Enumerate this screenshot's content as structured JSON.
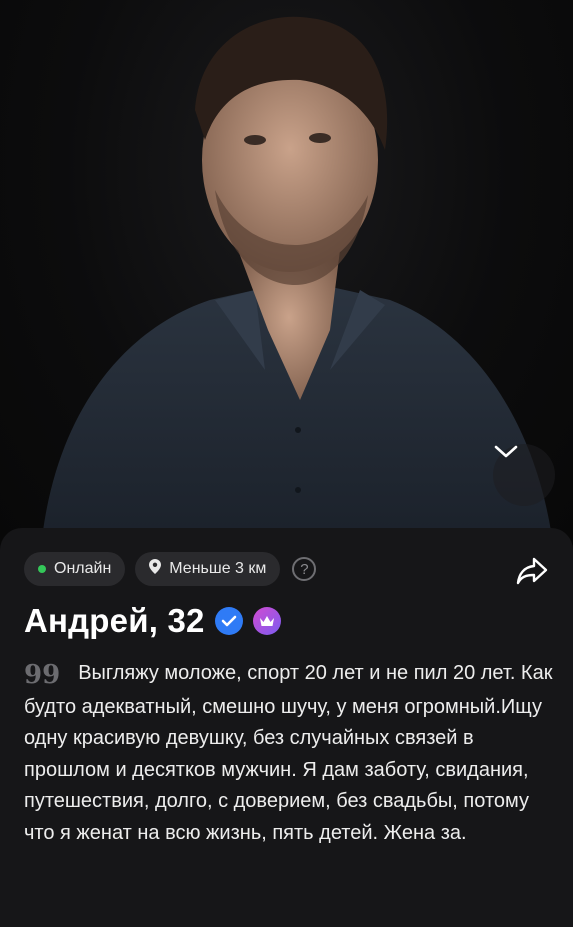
{
  "profile": {
    "status": "Онлайн",
    "distance": "Меньше 3 км",
    "help": "?",
    "name_age": "Андрей, 32",
    "bio": "Выгляжу моложе, спорт 20 лет и не пил 20 лет. Как будто адекватный, смешно шучу, у меня огромный.Ищу одну красивую девушку, без случайных связей в прошлом и десятков мужчин. Я дам заботу, свидания, путешествия, долго, с доверием, без свадьбы, потому что я женат на всю жизнь, пять детей. Жена за."
  },
  "icons": {
    "expand": "chevron-down-icon",
    "location": "location-pin-icon",
    "share": "share-arrow-icon",
    "verified": "verified-check-icon",
    "premium": "crown-icon",
    "quote": "quote-icon"
  },
  "colors": {
    "online": "#34c759",
    "verified": "#2f7bf6",
    "premium_start": "#d24bd1",
    "premium_end": "#7b5cf0",
    "card_bg": "#161618",
    "chip_bg": "#2a2a2d"
  }
}
